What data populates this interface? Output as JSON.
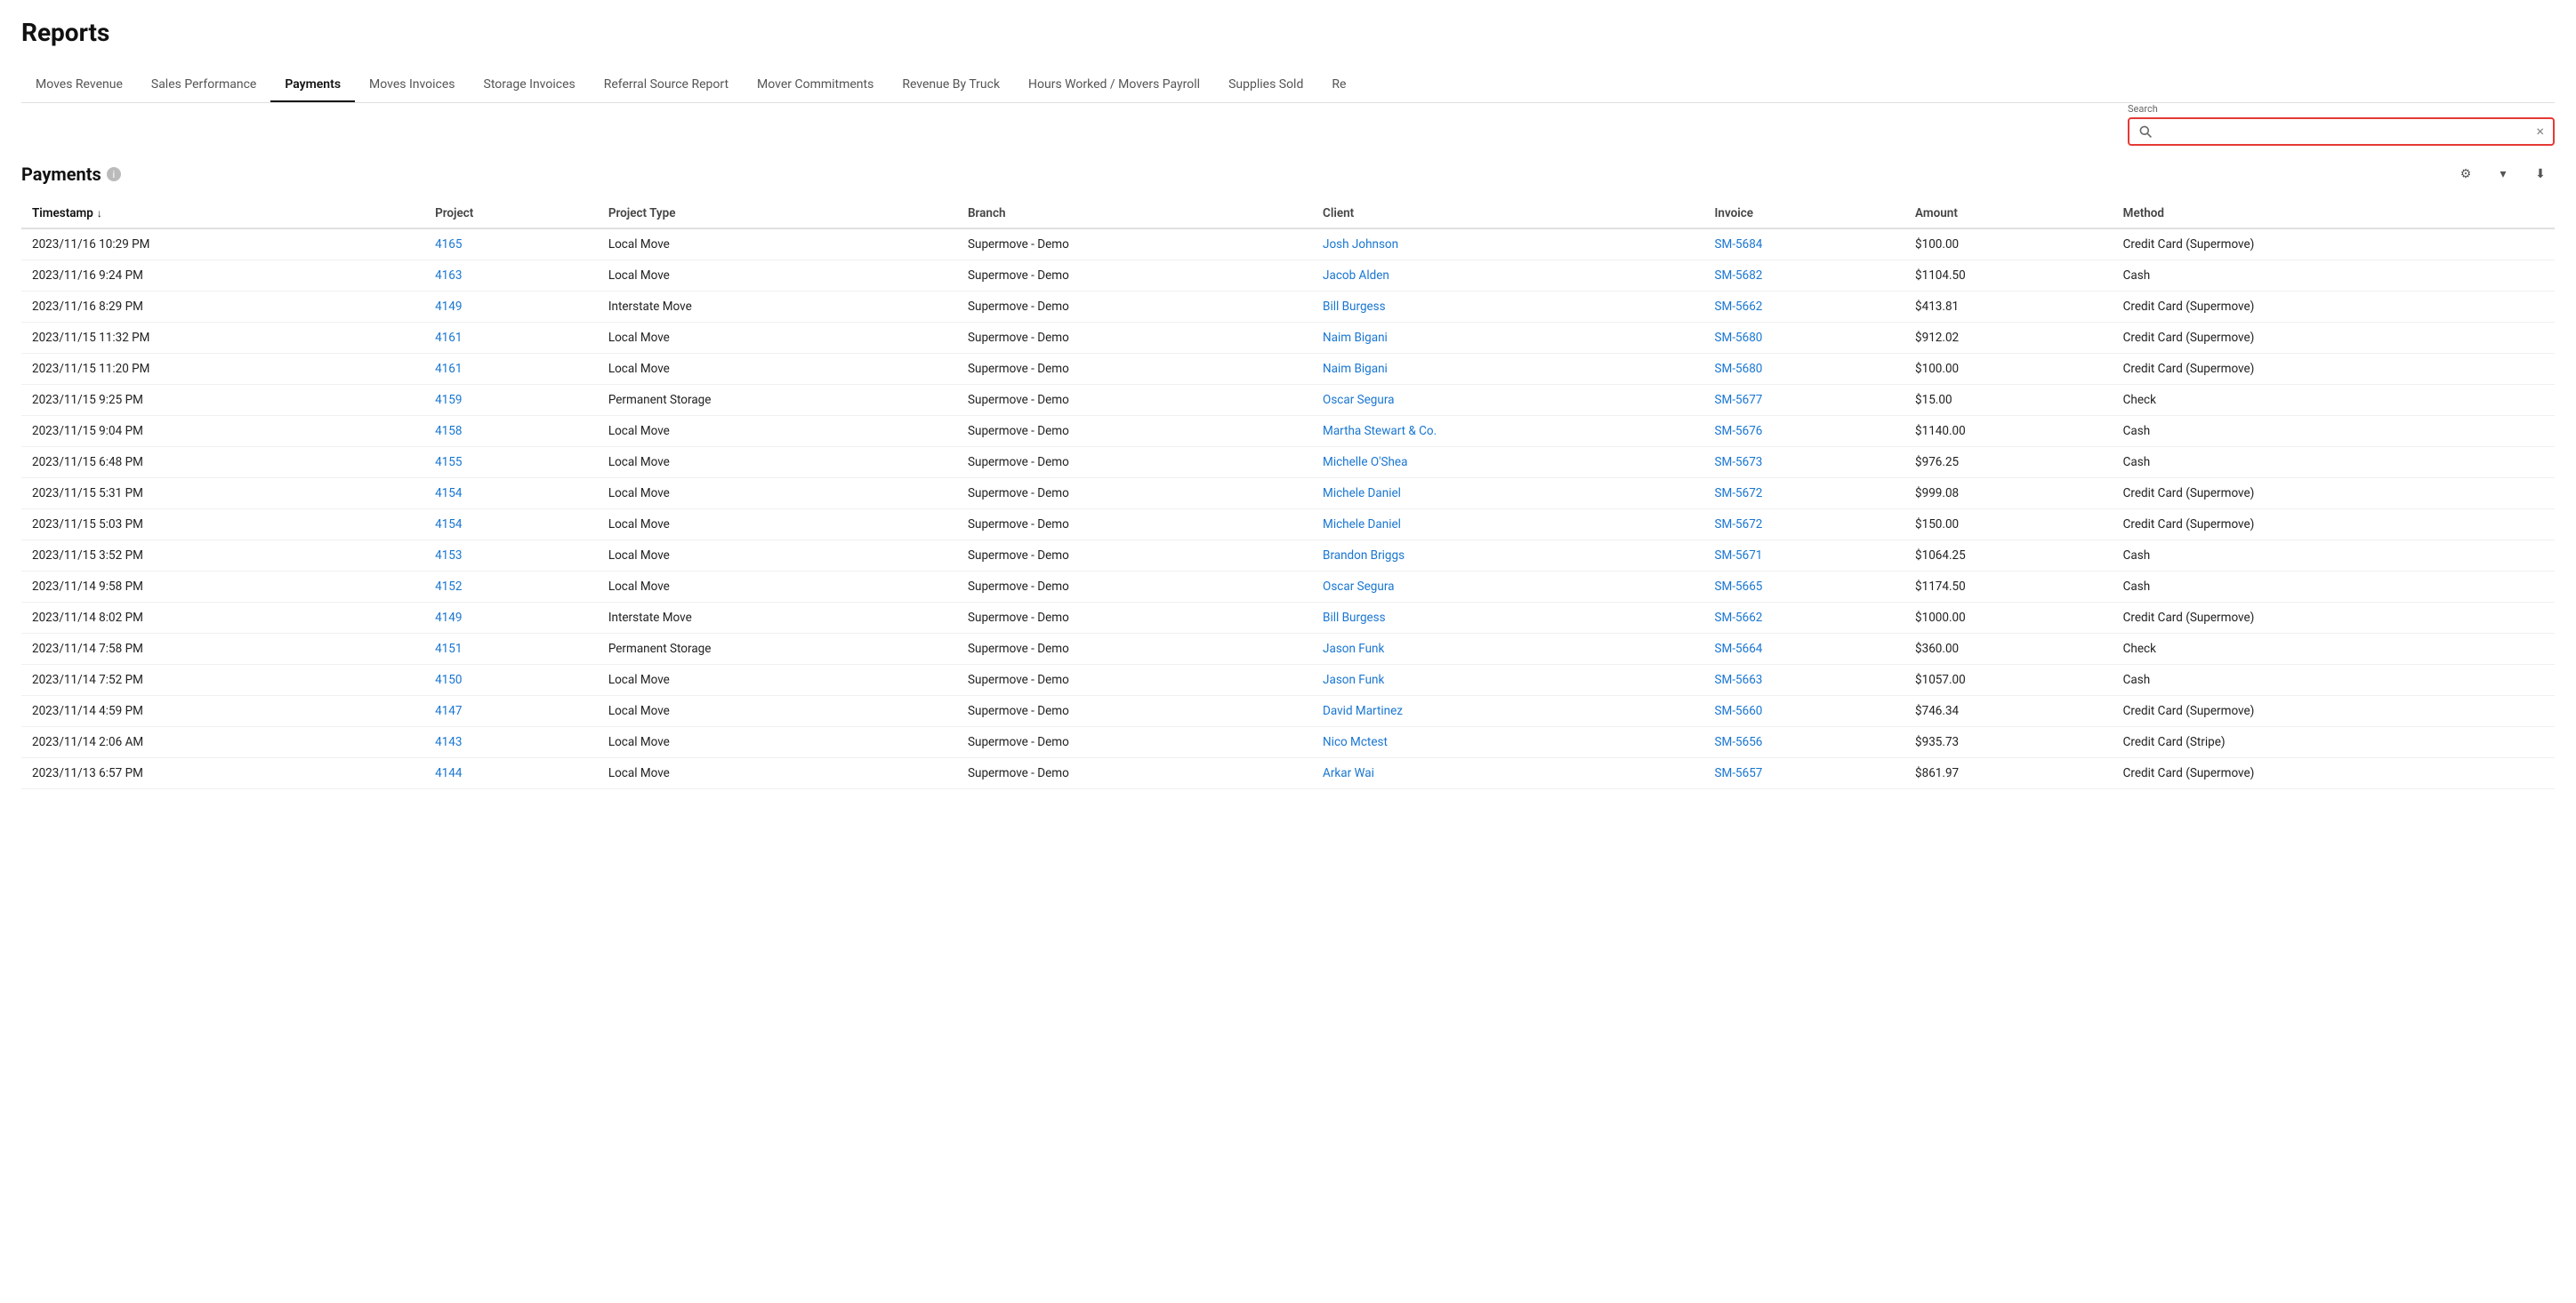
{
  "page": {
    "title": "Reports"
  },
  "tabs": [
    {
      "id": "moves-revenue",
      "label": "Moves Revenue",
      "active": false
    },
    {
      "id": "sales-performance",
      "label": "Sales Performance",
      "active": false
    },
    {
      "id": "payments",
      "label": "Payments",
      "active": true
    },
    {
      "id": "moves-invoices",
      "label": "Moves Invoices",
      "active": false
    },
    {
      "id": "storage-invoices",
      "label": "Storage Invoices",
      "active": false
    },
    {
      "id": "referral-source-report",
      "label": "Referral Source Report",
      "active": false
    },
    {
      "id": "mover-commitments",
      "label": "Mover Commitments",
      "active": false
    },
    {
      "id": "revenue-by-truck",
      "label": "Revenue By Truck",
      "active": false
    },
    {
      "id": "hours-worked-movers-payroll",
      "label": "Hours Worked / Movers Payroll",
      "active": false
    },
    {
      "id": "supplies-sold",
      "label": "Supplies Sold",
      "active": false
    },
    {
      "id": "re",
      "label": "Re",
      "active": false
    }
  ],
  "search": {
    "label": "Search",
    "placeholder": "",
    "value": ""
  },
  "table": {
    "title": "Payments",
    "columns": [
      {
        "id": "timestamp",
        "label": "Timestamp",
        "sorted": true,
        "sort_direction": "desc"
      },
      {
        "id": "project",
        "label": "Project"
      },
      {
        "id": "project_type",
        "label": "Project Type"
      },
      {
        "id": "branch",
        "label": "Branch"
      },
      {
        "id": "client",
        "label": "Client"
      },
      {
        "id": "invoice",
        "label": "Invoice"
      },
      {
        "id": "amount",
        "label": "Amount"
      },
      {
        "id": "method",
        "label": "Method"
      }
    ],
    "rows": [
      {
        "timestamp": "2023/11/16 10:29 PM",
        "project": "4165",
        "project_type": "Local Move",
        "branch": "Supermove - Demo",
        "client": "Josh Johnson",
        "invoice": "SM-5684",
        "amount": "$100.00",
        "method": "Credit Card (Supermove)"
      },
      {
        "timestamp": "2023/11/16 9:24 PM",
        "project": "4163",
        "project_type": "Local Move",
        "branch": "Supermove - Demo",
        "client": "Jacob Alden",
        "invoice": "SM-5682",
        "amount": "$1104.50",
        "method": "Cash"
      },
      {
        "timestamp": "2023/11/16 8:29 PM",
        "project": "4149",
        "project_type": "Interstate Move",
        "branch": "Supermove - Demo",
        "client": "Bill Burgess",
        "invoice": "SM-5662",
        "amount": "$413.81",
        "method": "Credit Card (Supermove)"
      },
      {
        "timestamp": "2023/11/15 11:32 PM",
        "project": "4161",
        "project_type": "Local Move",
        "branch": "Supermove - Demo",
        "client": "Naim Bigani",
        "invoice": "SM-5680",
        "amount": "$912.02",
        "method": "Credit Card (Supermove)"
      },
      {
        "timestamp": "2023/11/15 11:20 PM",
        "project": "4161",
        "project_type": "Local Move",
        "branch": "Supermove - Demo",
        "client": "Naim Bigani",
        "invoice": "SM-5680",
        "amount": "$100.00",
        "method": "Credit Card (Supermove)"
      },
      {
        "timestamp": "2023/11/15 9:25 PM",
        "project": "4159",
        "project_type": "Permanent Storage",
        "branch": "Supermove - Demo",
        "client": "Oscar Segura",
        "invoice": "SM-5677",
        "amount": "$15.00",
        "method": "Check"
      },
      {
        "timestamp": "2023/11/15 9:04 PM",
        "project": "4158",
        "project_type": "Local Move",
        "branch": "Supermove - Demo",
        "client": "Martha Stewart & Co.",
        "invoice": "SM-5676",
        "amount": "$1140.00",
        "method": "Cash"
      },
      {
        "timestamp": "2023/11/15 6:48 PM",
        "project": "4155",
        "project_type": "Local Move",
        "branch": "Supermove - Demo",
        "client": "Michelle O'Shea",
        "invoice": "SM-5673",
        "amount": "$976.25",
        "method": "Cash"
      },
      {
        "timestamp": "2023/11/15 5:31 PM",
        "project": "4154",
        "project_type": "Local Move",
        "branch": "Supermove - Demo",
        "client": "Michele Daniel",
        "invoice": "SM-5672",
        "amount": "$999.08",
        "method": "Credit Card (Supermove)"
      },
      {
        "timestamp": "2023/11/15 5:03 PM",
        "project": "4154",
        "project_type": "Local Move",
        "branch": "Supermove - Demo",
        "client": "Michele Daniel",
        "invoice": "SM-5672",
        "amount": "$150.00",
        "method": "Credit Card (Supermove)"
      },
      {
        "timestamp": "2023/11/15 3:52 PM",
        "project": "4153",
        "project_type": "Local Move",
        "branch": "Supermove - Demo",
        "client": "Brandon Briggs",
        "invoice": "SM-5671",
        "amount": "$1064.25",
        "method": "Cash"
      },
      {
        "timestamp": "2023/11/14 9:58 PM",
        "project": "4152",
        "project_type": "Local Move",
        "branch": "Supermove - Demo",
        "client": "Oscar Segura",
        "invoice": "SM-5665",
        "amount": "$1174.50",
        "method": "Cash"
      },
      {
        "timestamp": "2023/11/14 8:02 PM",
        "project": "4149",
        "project_type": "Interstate Move",
        "branch": "Supermove - Demo",
        "client": "Bill Burgess",
        "invoice": "SM-5662",
        "amount": "$1000.00",
        "method": "Credit Card (Supermove)"
      },
      {
        "timestamp": "2023/11/14 7:58 PM",
        "project": "4151",
        "project_type": "Permanent Storage",
        "branch": "Supermove - Demo",
        "client": "Jason Funk",
        "invoice": "SM-5664",
        "amount": "$360.00",
        "method": "Check"
      },
      {
        "timestamp": "2023/11/14 7:52 PM",
        "project": "4150",
        "project_type": "Local Move",
        "branch": "Supermove - Demo",
        "client": "Jason Funk",
        "invoice": "SM-5663",
        "amount": "$1057.00",
        "method": "Cash"
      },
      {
        "timestamp": "2023/11/14 4:59 PM",
        "project": "4147",
        "project_type": "Local Move",
        "branch": "Supermove - Demo",
        "client": "David Martinez",
        "invoice": "SM-5660",
        "amount": "$746.34",
        "method": "Credit Card (Supermove)"
      },
      {
        "timestamp": "2023/11/14 2:06 AM",
        "project": "4143",
        "project_type": "Local Move",
        "branch": "Supermove - Demo",
        "client": "Nico Mctest",
        "invoice": "SM-5656",
        "amount": "$935.73",
        "method": "Credit Card (Stripe)"
      },
      {
        "timestamp": "2023/11/13 6:57 PM",
        "project": "4144",
        "project_type": "Local Move",
        "branch": "Supermove - Demo",
        "client": "Arkar Wai",
        "invoice": "SM-5657",
        "amount": "$861.97",
        "method": "Credit Card (Supermove)"
      }
    ]
  },
  "actions": {
    "settings_icon": "⚙",
    "filter_icon": "▾",
    "download_icon": "⬇"
  }
}
